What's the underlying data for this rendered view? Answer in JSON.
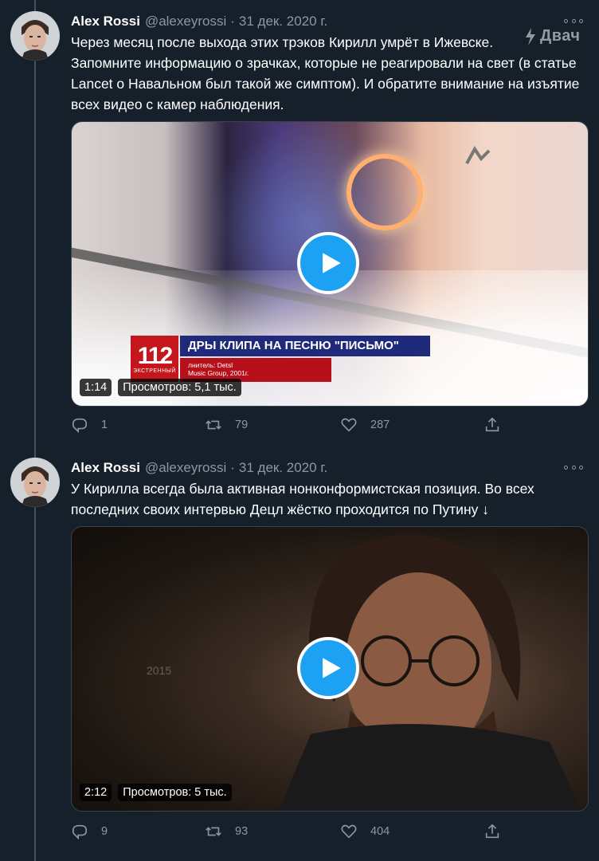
{
  "watermark": "Двач",
  "tweets": [
    {
      "author": {
        "name": "Alex Rossi",
        "handle": "@alexeyrossi",
        "date": "31 дек. 2020 г."
      },
      "text": "Через месяц после выхода этих трэков Кирилл умрёт в Ижевске.\nЗапомните информацию о зрачках, которые не реагировали на свет (в статье Lancet о Навальном был такой же симптом). И обратите внимание на изъятие всех видео с камер наблюдения.",
      "video": {
        "duration": "1:14",
        "views": "Просмотров: 5,1 тыс.",
        "overlay": {
          "channel_logo": "112",
          "channel_sub": "ЭКСТРЕННЫЙ",
          "headline": "ДРЫ КЛИПА НА ПЕСНЮ \"ПИСЬМО\"",
          "sub_line1": "лнитель: Detsl",
          "sub_line2": "Music Group, 2001г."
        }
      },
      "actions": {
        "replies": "1",
        "retweets": "79",
        "likes": "287"
      }
    },
    {
      "author": {
        "name": "Alex Rossi",
        "handle": "@alexeyrossi",
        "date": "31 дек. 2020 г."
      },
      "text": "У Кирилла всегда была активная нонконформистская позиция. Во всех последних своих интервью Децл жёстко проходится по Путину ↓",
      "video": {
        "duration": "2:12",
        "views": "Просмотров: 5 тыс.",
        "overlay": {
          "year": "2015"
        }
      },
      "actions": {
        "replies": "9",
        "retweets": "93",
        "likes": "404"
      }
    }
  ],
  "icons": {
    "reply": "reply-icon",
    "retweet": "retweet-icon",
    "like": "heart-icon",
    "share": "share-icon",
    "play": "play-icon",
    "more": "more-icon"
  },
  "colors": {
    "background": "#15202b",
    "accent": "#1da1f2",
    "muted": "#8899a6",
    "text": "#ffffff"
  }
}
